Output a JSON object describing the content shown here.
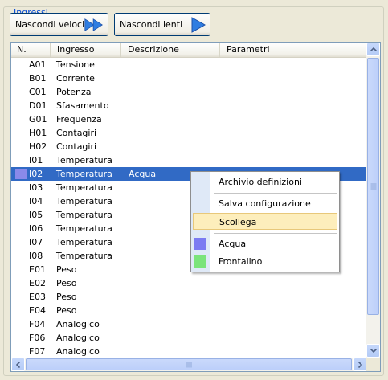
{
  "group": {
    "title": "Ingressi"
  },
  "buttons": {
    "fast": "Nascondi veloci",
    "slow": "Nascondi lenti"
  },
  "columns": [
    "N.",
    "Ingresso",
    "Descrizione",
    "Parametri"
  ],
  "rows": [
    {
      "n": "A01",
      "ingresso": "Tensione",
      "descrizione": ""
    },
    {
      "n": "B01",
      "ingresso": "Corrente",
      "descrizione": ""
    },
    {
      "n": "C01",
      "ingresso": "Potenza",
      "descrizione": ""
    },
    {
      "n": "D01",
      "ingresso": "Sfasamento",
      "descrizione": ""
    },
    {
      "n": "G01",
      "ingresso": "Frequenza",
      "descrizione": ""
    },
    {
      "n": "H01",
      "ingresso": "Contagiri",
      "descrizione": ""
    },
    {
      "n": "H02",
      "ingresso": "Contagiri",
      "descrizione": ""
    },
    {
      "n": "I01",
      "ingresso": "Temperatura",
      "descrizione": ""
    },
    {
      "n": "I02",
      "ingresso": "Temperatura",
      "descrizione": "Acqua"
    },
    {
      "n": "I03",
      "ingresso": "Temperatura",
      "descrizione": ""
    },
    {
      "n": "I04",
      "ingresso": "Temperatura",
      "descrizione": ""
    },
    {
      "n": "I05",
      "ingresso": "Temperatura",
      "descrizione": ""
    },
    {
      "n": "I06",
      "ingresso": "Temperatura",
      "descrizione": ""
    },
    {
      "n": "I07",
      "ingresso": "Temperatura",
      "descrizione": ""
    },
    {
      "n": "I08",
      "ingresso": "Temperatura",
      "descrizione": ""
    },
    {
      "n": "E01",
      "ingresso": "Peso",
      "descrizione": ""
    },
    {
      "n": "E02",
      "ingresso": "Peso",
      "descrizione": ""
    },
    {
      "n": "E03",
      "ingresso": "Peso",
      "descrizione": ""
    },
    {
      "n": "E04",
      "ingresso": "Peso",
      "descrizione": ""
    },
    {
      "n": "F04",
      "ingresso": "Analogico",
      "descrizione": ""
    },
    {
      "n": "F06",
      "ingresso": "Analogico",
      "descrizione": ""
    },
    {
      "n": "F07",
      "ingresso": "Analogico",
      "descrizione": ""
    }
  ],
  "selected_row": "I02",
  "context_menu": {
    "items": [
      {
        "label": "Archivio definizioni"
      },
      {
        "label": "Salva configurazione"
      },
      {
        "label": "Scollega"
      },
      {
        "label": "Acqua",
        "swatch": "#7b7bf2"
      },
      {
        "label": "Frontalino",
        "swatch": "#7be47b"
      }
    ],
    "highlighted": "Scollega"
  },
  "colors": {
    "selection": "#316ac5",
    "accent_blue": "#0046d5",
    "arrow_blue": "#2f7de1"
  }
}
